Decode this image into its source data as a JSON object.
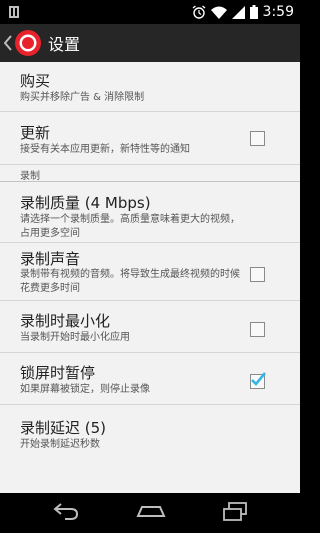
{
  "status_bar": {
    "time": "3:59",
    "icons": [
      "notification-icon",
      "alarm-icon",
      "wifi-icon",
      "signal-icon",
      "battery-icon"
    ]
  },
  "action_bar": {
    "title": "设置",
    "icon": "record-app-icon"
  },
  "items": {
    "purchase": {
      "title": "购买",
      "summary": "购买并移除广告 & 消除限制"
    },
    "update": {
      "title": "更新",
      "summary": "接受有关本应用更新，新特性等的通知",
      "checked": false
    },
    "category_record": "录制",
    "quality": {
      "title": "录制质量 (4 Mbps)",
      "summary": "请选择一个录制质量。高质量意味着更大的视频，占用更多空间"
    },
    "audio": {
      "title": "录制声音",
      "summary": "录制带有视频的音频。将导致生成最终视频的时候花费更多时间",
      "checked": false
    },
    "minimize": {
      "title": "录制时最小化",
      "summary": "当录制开始时最小化应用",
      "checked": false
    },
    "lock_pause": {
      "title": "锁屏时暂停",
      "summary": "如果屏幕被锁定，则停止录像",
      "checked": true
    },
    "delay": {
      "title": "录制延迟 (5)",
      "summary": "开始录制延迟秒数"
    }
  },
  "colors": {
    "accent": "#33b5e5",
    "record_red": "#e8232c"
  },
  "nav_bar": {
    "icons": [
      "back-icon",
      "home-icon",
      "recents-icon"
    ]
  }
}
